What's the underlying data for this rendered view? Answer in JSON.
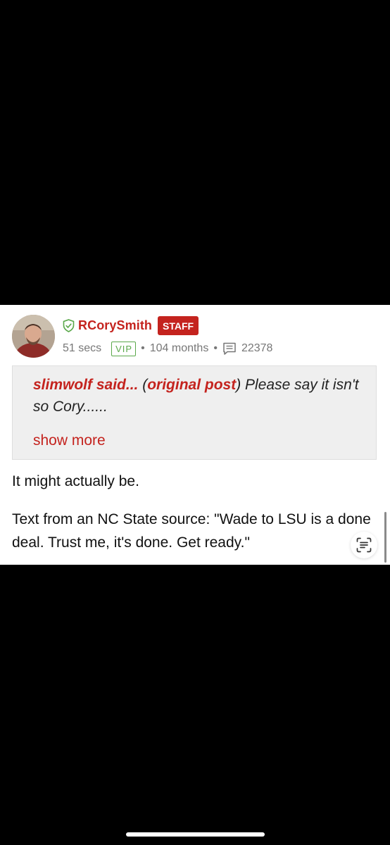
{
  "post": {
    "username": "RCorySmith",
    "staff_badge": "STAFF",
    "time_ago": "51 secs",
    "vip_badge": "VIP",
    "separator": "•",
    "membership": "104 months",
    "post_count": "22378"
  },
  "quote": {
    "author": "slimwolf said...",
    "open_paren": " (",
    "link_label": "original post",
    "close_paren": ")",
    "text": " Please say it isn't so Cory......",
    "show_more": "show more"
  },
  "body": {
    "line1": "It might actually be.",
    "paragraph": "Text from an NC State source: \"Wade to LSU is a done deal. Trust me, it's done. Get ready.\""
  },
  "icons": {
    "shield": "shield-check-icon",
    "comments": "comment-lines-icon",
    "text_scan": "live-text-icon"
  },
  "colors": {
    "accent": "#c4231e",
    "vip": "#5aa84a",
    "meta": "#777777",
    "quote_bg": "#efefef"
  }
}
